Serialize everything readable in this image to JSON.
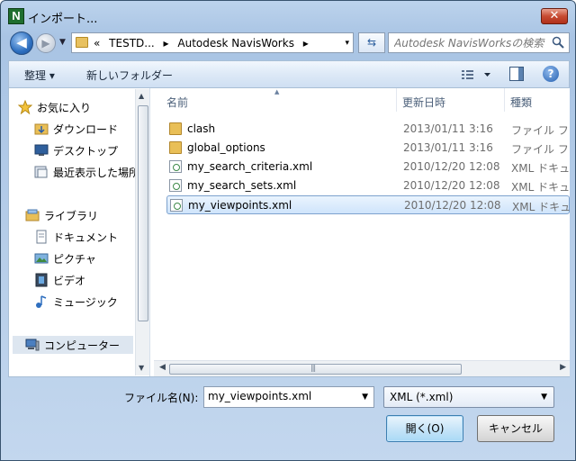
{
  "window": {
    "title": "インポート...",
    "app_icon_letter": "N",
    "close_glyph": "✕"
  },
  "address": {
    "prefix": "«",
    "crumbs": [
      "TESTD...",
      "Autodesk NavisWorks"
    ],
    "separator": "▸",
    "dropdown_glyph": "▾"
  },
  "search": {
    "placeholder": "Autodesk NavisWorksの検索"
  },
  "toolbar": {
    "organize_label": "整理 ▾",
    "new_folder_label": "新しいフォルダー"
  },
  "nav": {
    "favorites": {
      "label": "お気に入り",
      "icon": "star-icon"
    },
    "items": [
      {
        "label": "ダウンロード",
        "icon": "download-folder-icon"
      },
      {
        "label": "デスクトップ",
        "icon": "desktop-icon"
      },
      {
        "label": "最近表示した場所",
        "icon": "recent-places-icon"
      }
    ],
    "libraries": {
      "label": "ライブラリ",
      "icon": "library-icon"
    },
    "library_items": [
      {
        "label": "ドキュメント",
        "icon": "documents-icon"
      },
      {
        "label": "ピクチャ",
        "icon": "pictures-icon"
      },
      {
        "label": "ビデオ",
        "icon": "videos-icon"
      },
      {
        "label": "ミュージック",
        "icon": "music-icon"
      }
    ],
    "computer": {
      "label": "コンピューター",
      "icon": "computer-icon"
    }
  },
  "columns": {
    "name": "名前",
    "modified": "更新日時",
    "type": "種類"
  },
  "files": [
    {
      "name": "clash",
      "modified": "2013/01/11 3:16",
      "type": "ファイル フォルダー",
      "kind": "folder"
    },
    {
      "name": "global_options",
      "modified": "2013/01/11 3:16",
      "type": "ファイル フォルダー",
      "kind": "folder"
    },
    {
      "name": "my_search_criteria.xml",
      "modified": "2010/12/20 12:08",
      "type": "XML ドキュメント",
      "kind": "xml"
    },
    {
      "name": "my_search_sets.xml",
      "modified": "2010/12/20 12:08",
      "type": "XML ドキュメント",
      "kind": "xml"
    },
    {
      "name": "my_viewpoints.xml",
      "modified": "2010/12/20 12:08",
      "type": "XML ドキュメント",
      "kind": "xml",
      "selected": true
    }
  ],
  "bottom": {
    "filename_label": "ファイル名(N):",
    "filename_value": "my_viewpoints.xml",
    "filetype_value": "XML (*.xml)",
    "open_label": "開く(O)",
    "cancel_label": "キャンセル"
  },
  "colors": {
    "selection_border": "#7da2ce",
    "close_button": "#c74b32",
    "frame": "#a9c4e4"
  }
}
